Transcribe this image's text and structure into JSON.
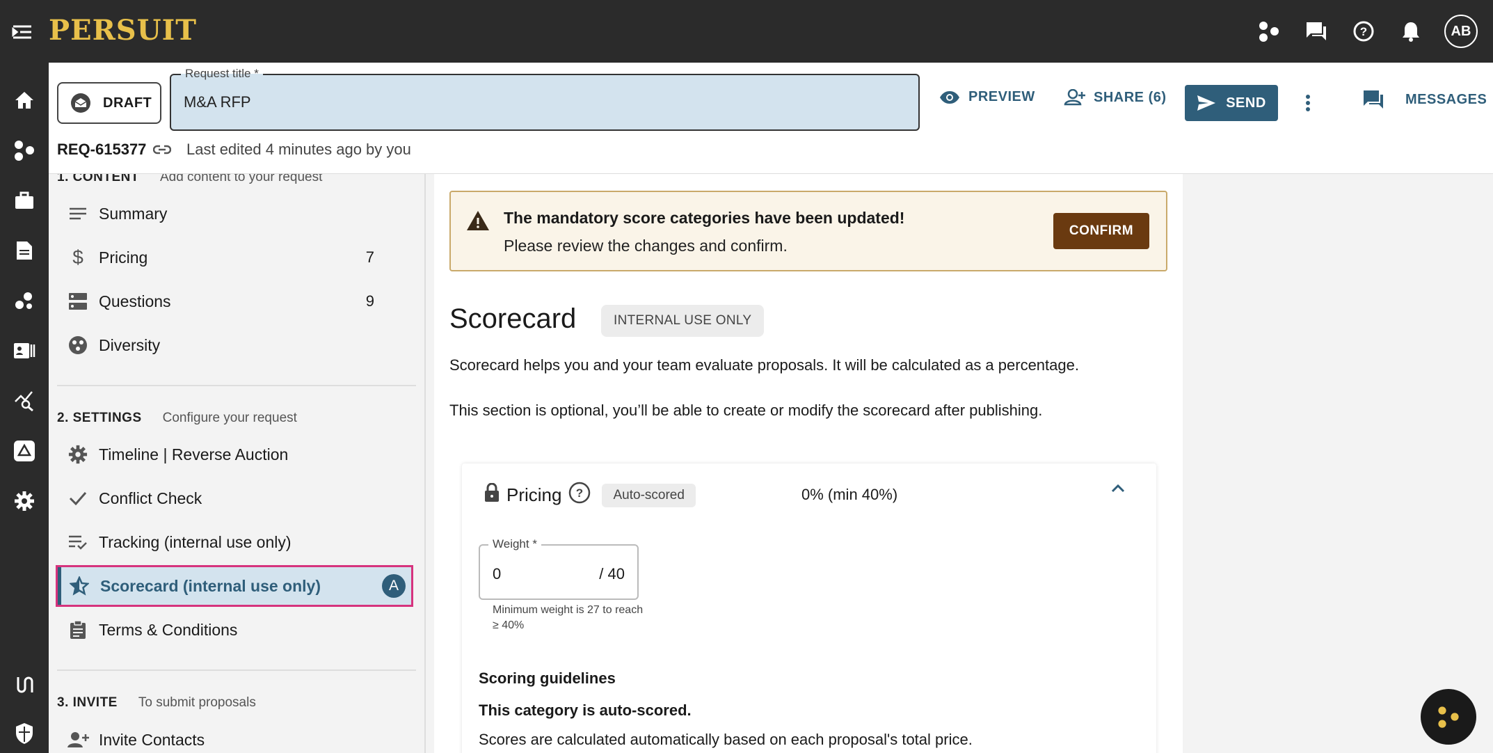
{
  "app": {
    "logo": "PERSUIT"
  },
  "topbar": {
    "avatar": "AB"
  },
  "header": {
    "draft_label": "DRAFT",
    "title_label": "Request title *",
    "title_value": "M&A RFP",
    "preview_label": "PREVIEW",
    "share_label": "SHARE (6)",
    "send_label": "SEND",
    "messages_label": "MESSAGES",
    "request_id": "REQ-615377",
    "last_edited": "Last edited 4 minutes ago by you"
  },
  "sidebar": {
    "content_section": {
      "num": "1. CONTENT",
      "desc": "Add content to your request"
    },
    "content_items": [
      {
        "label": "Summary",
        "count": ""
      },
      {
        "label": "Pricing",
        "count": "7"
      },
      {
        "label": "Questions",
        "count": "9"
      },
      {
        "label": "Diversity",
        "count": ""
      }
    ],
    "settings_section": {
      "num": "2. SETTINGS",
      "desc": "Configure your request"
    },
    "settings_items": [
      {
        "label": "Timeline | Reverse Auction"
      },
      {
        "label": "Conflict Check"
      },
      {
        "label": "Tracking (internal use only)"
      },
      {
        "label": "Scorecard (internal use only)",
        "badge": "A"
      },
      {
        "label": "Terms & Conditions"
      }
    ],
    "invite_section": {
      "num": "3. INVITE",
      "desc": "To submit proposals"
    },
    "invite_items": [
      {
        "label": "Invite Contacts"
      }
    ]
  },
  "alert": {
    "title": "The mandatory score categories have been updated!",
    "subtitle": "Please review the changes and confirm.",
    "confirm_label": "CONFIRM"
  },
  "scorecard": {
    "title": "Scorecard",
    "chip": "INTERNAL USE ONLY",
    "para1": "Scorecard helps you and your team evaluate proposals. It will be calculated as a percentage.",
    "para2": "This section is optional, you’ll be able to create or modify the scorecard after publishing.",
    "pricing": {
      "title": "Pricing",
      "auto_chip": "Auto-scored",
      "percent": "0% (min 40%)",
      "weight_label": "Weight *",
      "weight_value": "0",
      "weight_max": "/ 40",
      "weight_help": "Minimum weight is 27 to reach ≥ 40%",
      "guidelines_title": "Scoring guidelines",
      "guidelines_bold": "This category is auto-scored.",
      "guidelines_text": "Scores are calculated automatically based on each proposal's total price."
    }
  },
  "colors": {
    "accent": "#2f5e7a",
    "logo": "#e8c04a",
    "confirm": "#6a3a10",
    "highlight": "#d6337d"
  }
}
